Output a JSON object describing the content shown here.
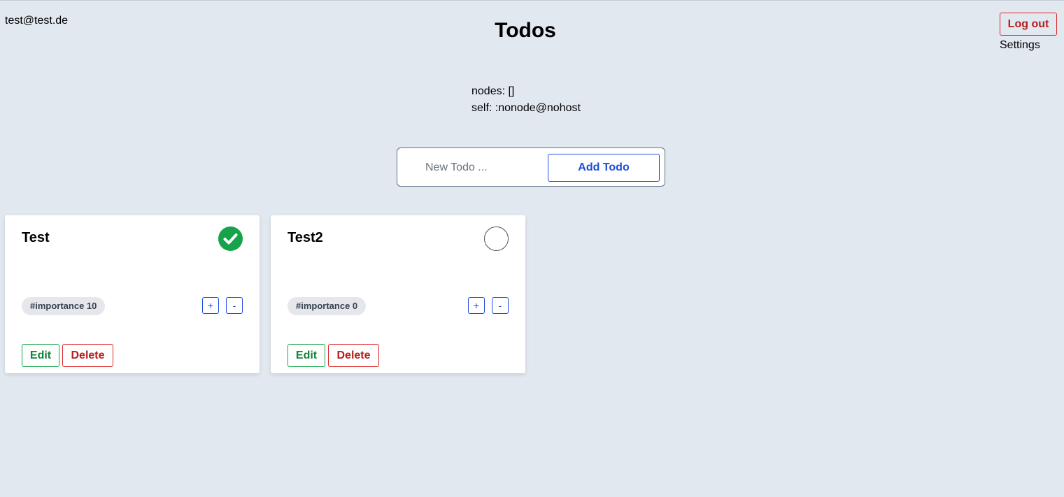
{
  "header": {
    "user_email": "test@test.de",
    "title": "Todos",
    "logout_label": "Log out",
    "settings_label": "Settings"
  },
  "cluster": {
    "nodes_line": "nodes: []",
    "self_line": "self: :nonode@nohost"
  },
  "new_todo": {
    "placeholder": "New Todo ...",
    "value": "",
    "add_label": "Add Todo"
  },
  "todos": [
    {
      "title": "Test",
      "done": true,
      "tag": "#importance 10",
      "plus_label": "+",
      "minus_label": "-",
      "edit_label": "Edit",
      "delete_label": "Delete"
    },
    {
      "title": "Test2",
      "done": false,
      "tag": "#importance 0",
      "plus_label": "+",
      "minus_label": "-",
      "edit_label": "Edit",
      "delete_label": "Delete"
    }
  ],
  "colors": {
    "background": "#e2e8f0",
    "done_green": "#16a34a",
    "accent_blue": "#1d4ed8",
    "danger_red": "#dc2626"
  },
  "icons": {
    "done": "check-circle-icon",
    "not_done": "empty-circle-icon"
  }
}
